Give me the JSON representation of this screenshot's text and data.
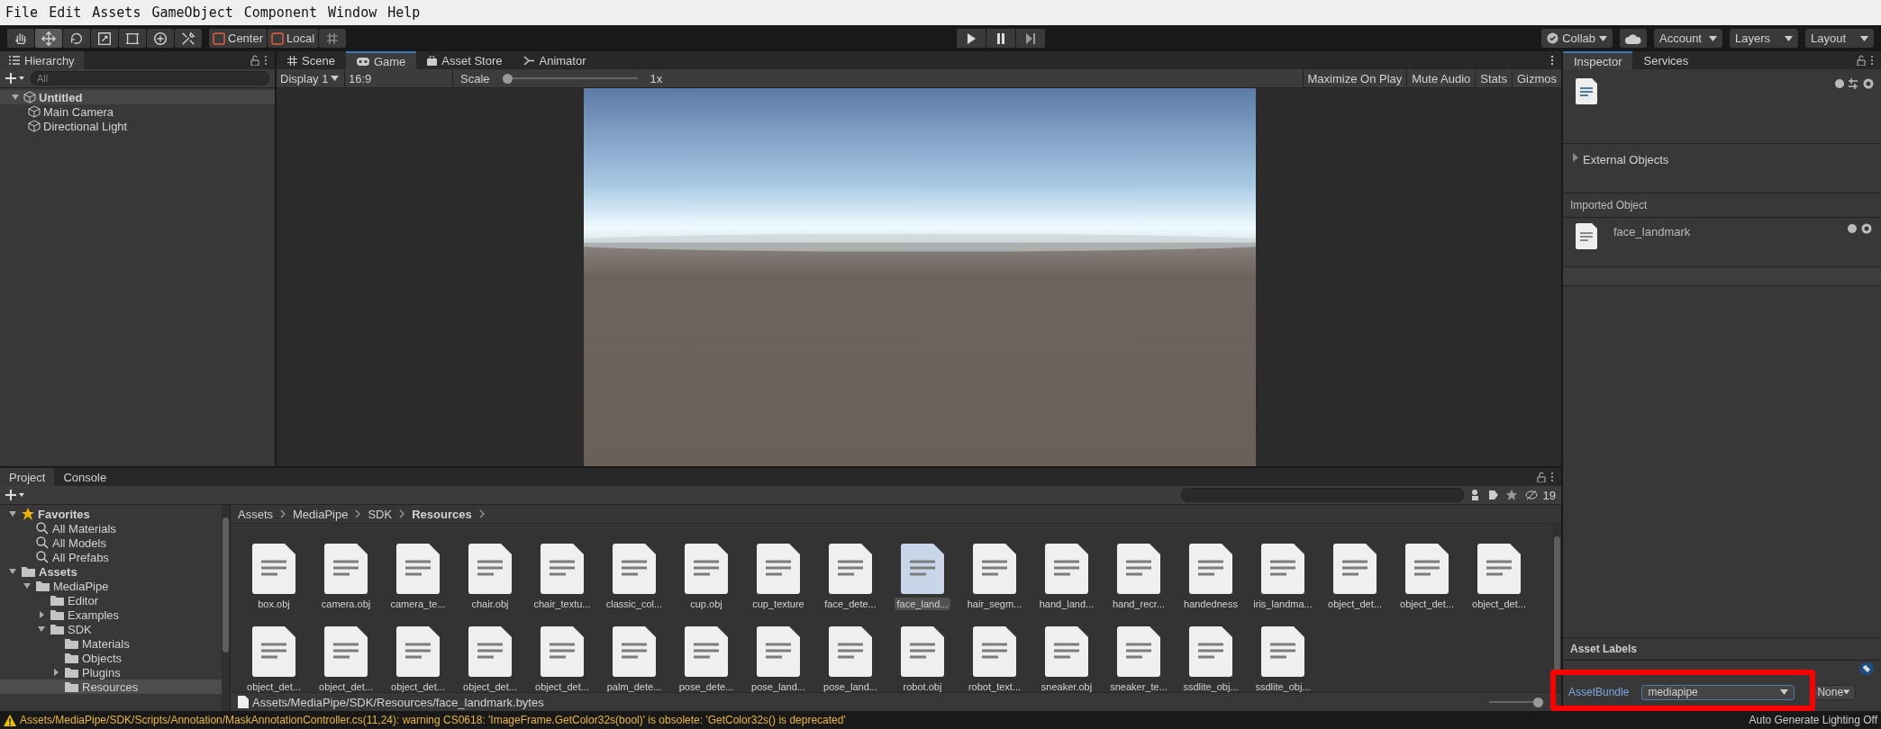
{
  "menu_bar": [
    "File",
    "Edit",
    "Assets",
    "GameObject",
    "Component",
    "Window",
    "Help"
  ],
  "toolbar": {
    "tools": [
      {
        "kind": "hand",
        "selected": false
      },
      {
        "kind": "move",
        "selected": true
      },
      {
        "kind": "rotate",
        "selected": false
      },
      {
        "kind": "scale",
        "selected": false
      },
      {
        "kind": "rect",
        "selected": false
      },
      {
        "kind": "transform",
        "selected": false
      },
      {
        "kind": "custom",
        "selected": false
      }
    ],
    "pivot": [
      "Center",
      "Local"
    ],
    "right": [
      "Collab",
      "Account",
      "Layers",
      "Layout"
    ]
  },
  "hierarchy": {
    "title": "Hierarchy",
    "search": {
      "placeholder": "All"
    },
    "items": [
      {
        "label": "Untitled",
        "expanded": true,
        "children": [
          {
            "label": "Main Camera"
          },
          {
            "label": "Directional Light"
          }
        ]
      }
    ]
  },
  "view_tabs": [
    {
      "label": "Scene",
      "kind": "scene",
      "selected": false
    },
    {
      "label": "Game",
      "kind": "game",
      "selected": true
    },
    {
      "label": "Asset Store",
      "kind": "store",
      "selected": false
    },
    {
      "label": "Animator",
      "kind": "animator",
      "selected": false
    }
  ],
  "game_toolbar": {
    "display": "Display 1",
    "aspect": "16:9",
    "scale_label": "Scale",
    "scale": {
      "level": 0
    },
    "scale_reading": "1x",
    "buttons": [
      "Maximize On Play",
      "Mute Audio",
      "Stats",
      "Gizmos"
    ]
  },
  "inspector": {
    "tabs": [
      {
        "label": "Inspector",
        "selected": true
      },
      {
        "label": "Services",
        "selected": false
      }
    ],
    "external_objects": "External Objects",
    "imported_object": "Imported Object",
    "asset_name": "face_landmark",
    "asset_labels": "Asset Labels",
    "asset_bundle": {
      "label": "AssetBundle",
      "value": "mediapipe",
      "variant": "None"
    }
  },
  "project": {
    "tabs": [
      {
        "label": "Project",
        "selected": true
      },
      {
        "label": "Console",
        "selected": false
      }
    ],
    "tree": [
      {
        "label": "Favorites",
        "kind": "favorites",
        "expanded": true,
        "selected": false,
        "children": [
          {
            "label": "All Materials",
            "kind": "search",
            "selected": false
          },
          {
            "label": "All Models",
            "kind": "search",
            "selected": false
          },
          {
            "label": "All Prefabs",
            "kind": "search",
            "selected": false
          }
        ]
      },
      {
        "label": "Assets",
        "kind": "folder",
        "expanded": true,
        "selected": false,
        "children": [
          {
            "label": "MediaPipe",
            "kind": "folder",
            "expanded": true,
            "selected": false,
            "children": [
              {
                "label": "Editor",
                "kind": "folder",
                "selected": false
              },
              {
                "label": "Examples",
                "kind": "folder",
                "expanded": false,
                "selected": false
              },
              {
                "label": "SDK",
                "kind": "folder",
                "expanded": true,
                "selected": false,
                "children": [
                  {
                    "label": "Materials",
                    "kind": "folder",
                    "selected": false
                  },
                  {
                    "label": "Objects",
                    "kind": "folder",
                    "selected": false
                  },
                  {
                    "label": "Plugins",
                    "kind": "folder",
                    "expanded": false,
                    "selected": false
                  },
                  {
                    "label": "Resources",
                    "kind": "folder",
                    "selected": true
                  }
                ]
              }
            ]
          }
        ]
      }
    ],
    "breadcrumb": [
      "Assets",
      "MediaPipe",
      "SDK",
      "Resources"
    ],
    "hidden_count": "19",
    "icon_size": {
      "level": 1
    },
    "files": [
      {
        "name": "box.obj",
        "selected": false
      },
      {
        "name": "camera.obj",
        "selected": false
      },
      {
        "name": "camera_te...",
        "selected": false
      },
      {
        "name": "chair.obj",
        "selected": false
      },
      {
        "name": "chair_textu...",
        "selected": false
      },
      {
        "name": "classic_col...",
        "selected": false
      },
      {
        "name": "cup.obj",
        "selected": false
      },
      {
        "name": "cup_texture",
        "selected": false
      },
      {
        "name": "face_dete...",
        "selected": false
      },
      {
        "name": "face_land...",
        "selected": true
      },
      {
        "name": "hair_segm...",
        "selected": false
      },
      {
        "name": "hand_land...",
        "selected": false
      },
      {
        "name": "hand_recr...",
        "selected": false
      },
      {
        "name": "handedness",
        "selected": false
      },
      {
        "name": "iris_landma...",
        "selected": false
      },
      {
        "name": "object_det...",
        "selected": false
      },
      {
        "name": "object_det...",
        "selected": false
      },
      {
        "name": "object_det...",
        "selected": false
      },
      {
        "name": "object_det...",
        "selected": false
      },
      {
        "name": "object_det...",
        "selected": false
      },
      {
        "name": "object_det...",
        "selected": false
      },
      {
        "name": "object_det...",
        "selected": false
      },
      {
        "name": "object_det...",
        "selected": false
      },
      {
        "name": "palm_dete...",
        "selected": false
      },
      {
        "name": "pose_dete...",
        "selected": false
      },
      {
        "name": "pose_land...",
        "selected": false
      },
      {
        "name": "pose_land...",
        "selected": false
      },
      {
        "name": "robot.obj",
        "selected": false
      },
      {
        "name": "robot_text...",
        "selected": false
      },
      {
        "name": "sneaker.obj",
        "selected": false
      },
      {
        "name": "sneaker_te...",
        "selected": false
      },
      {
        "name": "ssdlite_obj...",
        "selected": false
      },
      {
        "name": "ssdlite_obj...",
        "selected": false
      }
    ],
    "path": "Assets/MediaPipe/SDK/Resources/face_landmark.bytes"
  },
  "status_bar": {
    "message": "Assets/MediaPipe/SDK/Scripts/Annotation/MaskAnnotationController.cs(11,24): warning CS0618: 'ImageFrame.GetColor32s(bool)' is obsolete: 'GetColor32s() is deprecated'",
    "lighting": "Auto Generate Lighting Off"
  }
}
